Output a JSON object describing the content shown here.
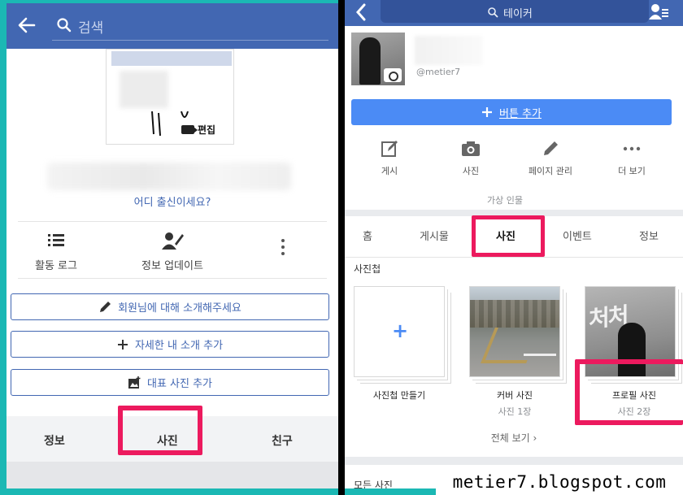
{
  "left_panel": {
    "search_placeholder": "검색",
    "edit_label": "편집",
    "hometown_prompt": "어디 출신이세요?",
    "actions": [
      {
        "icon": "list-icon",
        "label": "활동 로그"
      },
      {
        "icon": "person-edit-icon",
        "label": "정보 업데이트"
      },
      {
        "icon": "more-vertical-icon",
        "label": ""
      }
    ],
    "buttons": [
      {
        "icon": "pencil-icon",
        "label": "회원님에 대해 소개해주세요"
      },
      {
        "icon": "plus-icon",
        "label": "자세한 내 소개 추가"
      },
      {
        "icon": "photo-add-icon",
        "label": "대표 사진 추가"
      }
    ],
    "tabs": [
      "정보",
      "사진",
      "친구"
    ]
  },
  "right_panel": {
    "search_label": "테이커",
    "handle": "@metier7",
    "add_button_label": "버튼 추가",
    "actions": [
      {
        "icon": "compose-icon",
        "label": "게시"
      },
      {
        "icon": "camera-icon",
        "label": "사진"
      },
      {
        "icon": "pencil-icon",
        "label": "페이지 관리"
      },
      {
        "icon": "more-horizontal-icon",
        "label": "더 보기"
      }
    ],
    "category": "가상 인물",
    "tabs": [
      "홈",
      "게시물",
      "사진",
      "이벤트",
      "정보"
    ],
    "active_tab": "사진",
    "albums_title": "사진첩",
    "albums": [
      {
        "label": "사진첩 만들기",
        "count": ""
      },
      {
        "label": "커버 사진",
        "count": "사진 1장"
      },
      {
        "label": "프로필 사진",
        "count": "사진 2장"
      }
    ],
    "view_all": "전체 보기",
    "all_photos_title": "모든 사진"
  },
  "watermark": "metier7.blogspot.com",
  "colors": {
    "facebook_blue": "#4267b2",
    "button_blue": "#4b8bf5",
    "highlight_pink": "#ec1a5e",
    "frame_teal": "#1bb8b4"
  }
}
